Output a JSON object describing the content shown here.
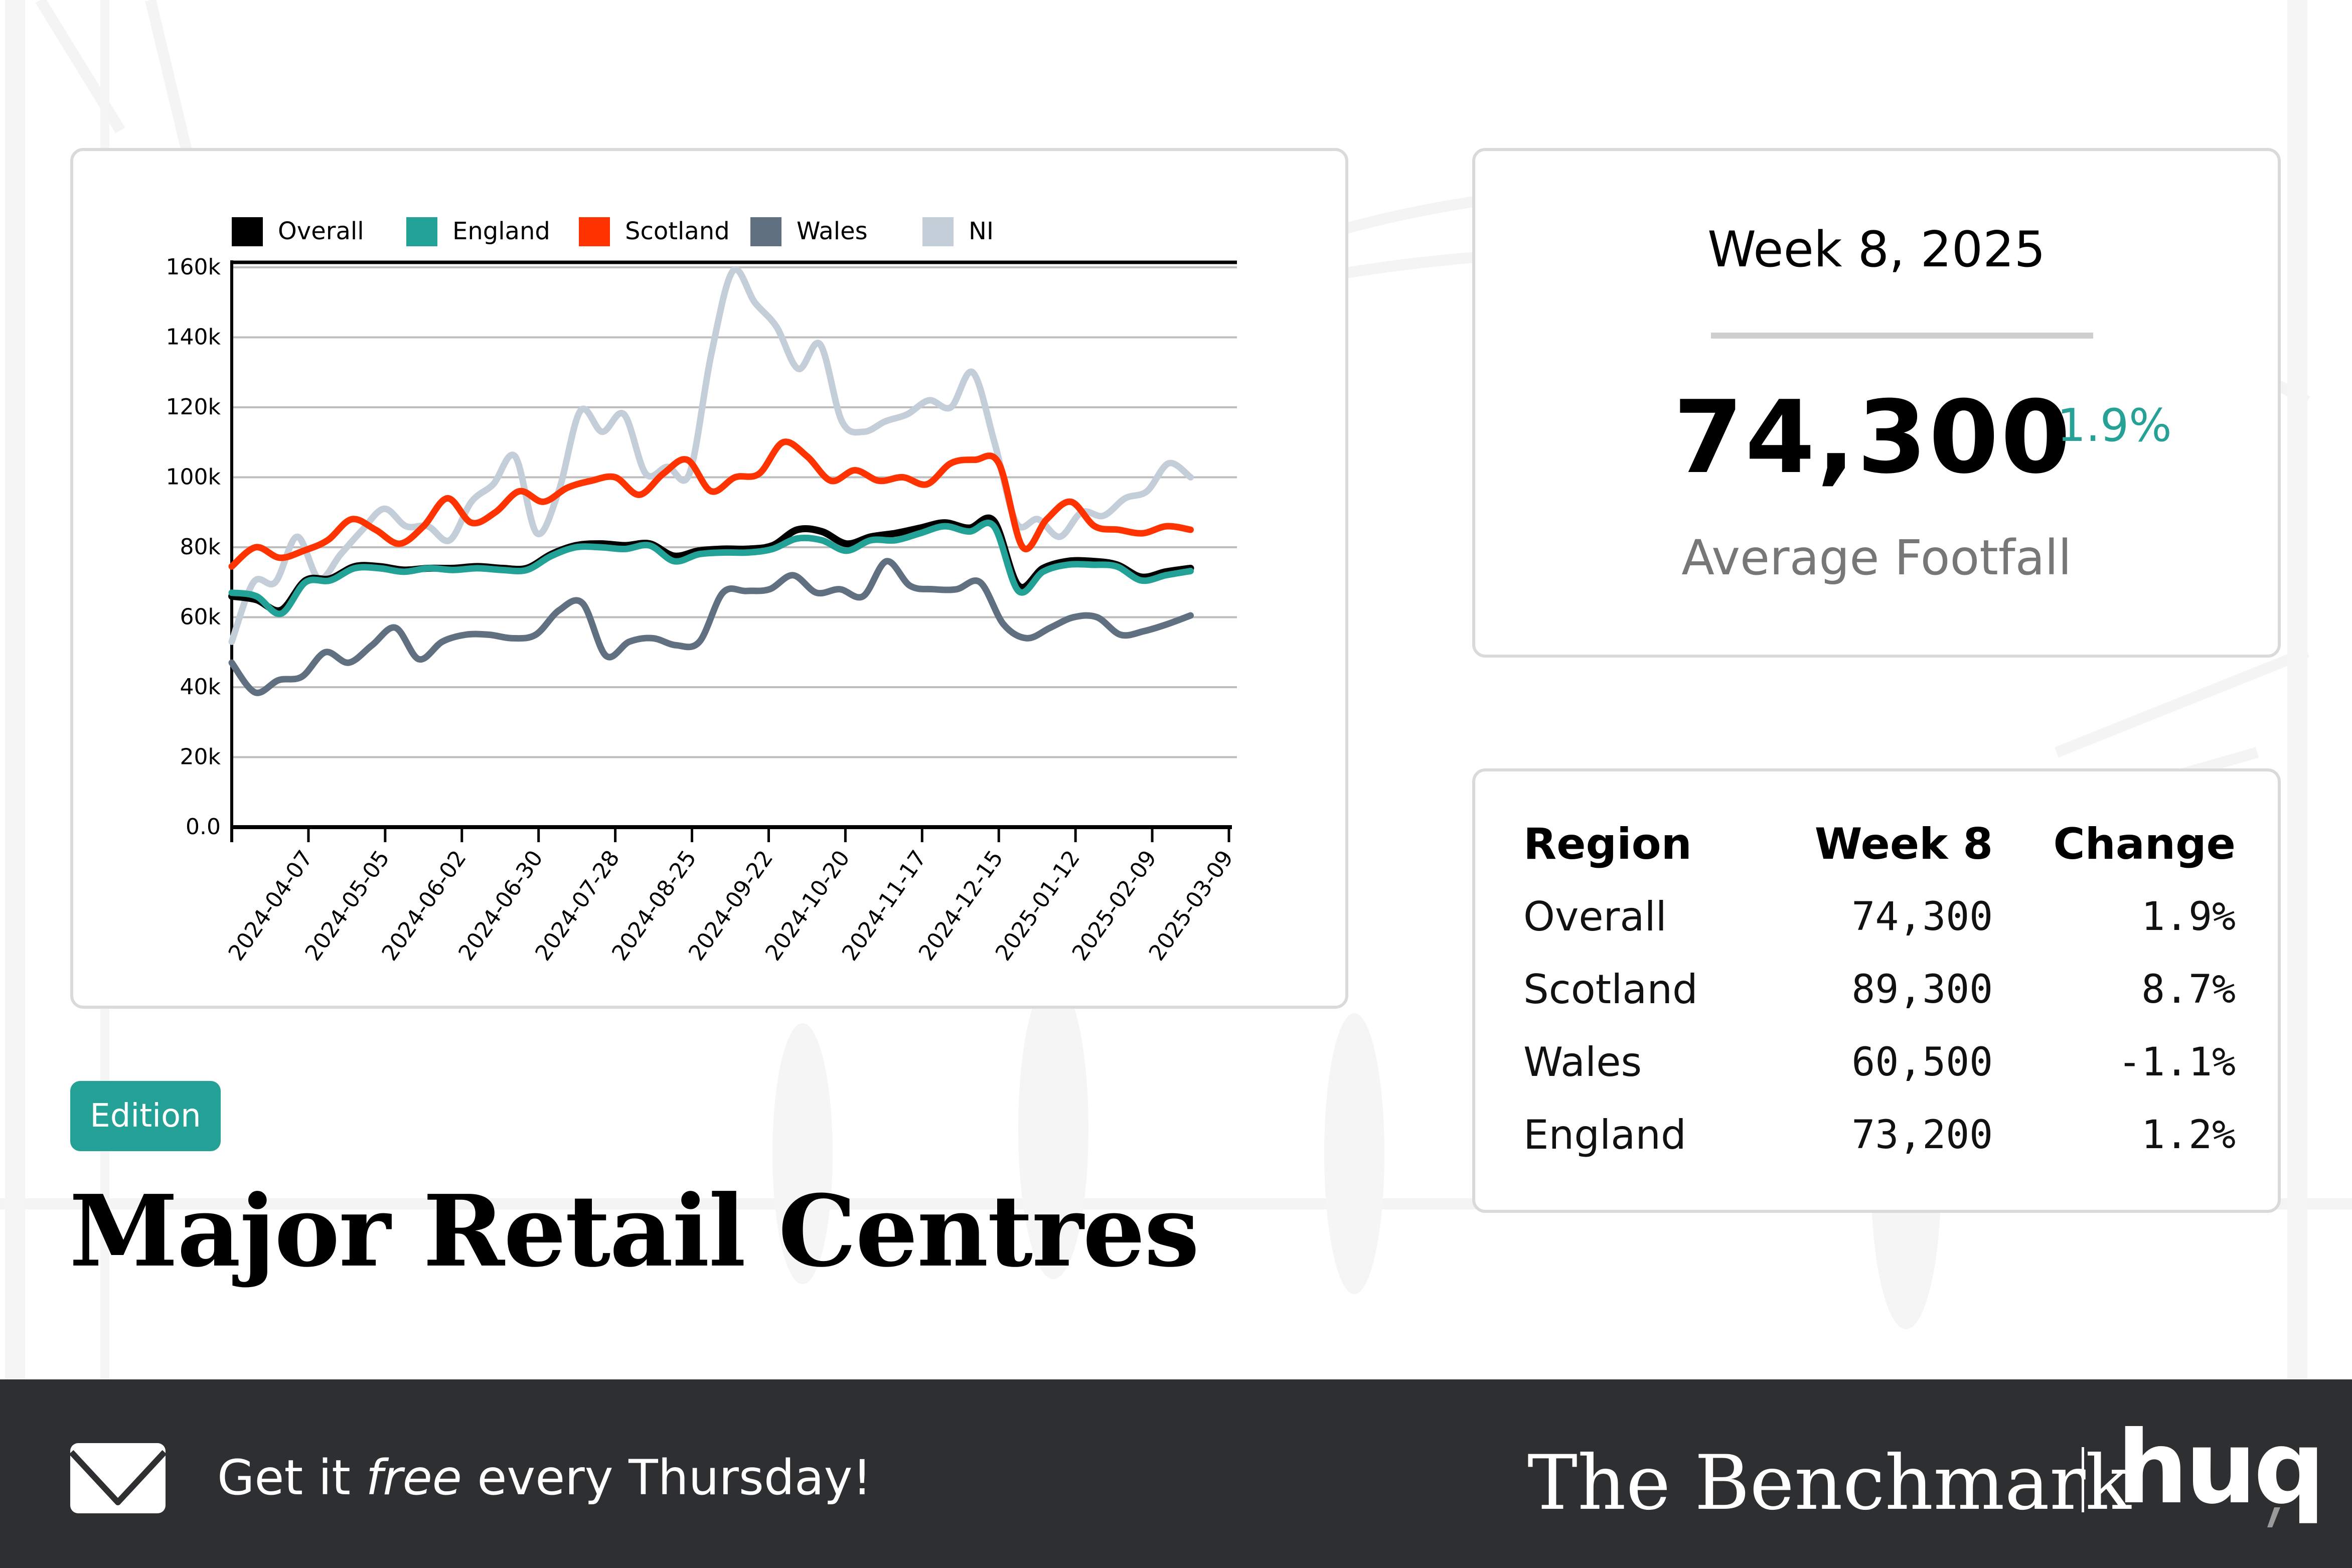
{
  "kpi": {
    "week_label": "Week 8, 2025",
    "value": "74,300",
    "change": "1.9%",
    "label": "Average Footfall",
    "change_color": "#26a196"
  },
  "table": {
    "headers": [
      "Region",
      "Week 8",
      "Change"
    ],
    "rows": [
      {
        "region": "Overall",
        "value": "74,300",
        "change": "1.9%"
      },
      {
        "region": "Scotland",
        "value": "89,300",
        "change": "8.7%"
      },
      {
        "region": "Wales",
        "value": "60,500",
        "change": "-1.1%"
      },
      {
        "region": "England",
        "value": "73,200",
        "change": "1.2%"
      }
    ]
  },
  "badge": "Edition",
  "title": "Major Retail Centres",
  "footer": {
    "cta_before": "Get it ",
    "cta_emphasis": "free",
    "cta_after": " every Thursday!",
    "brand": "The Benchmark",
    "logo": "huq",
    "mail_icon": "envelope-icon"
  },
  "chart_data": {
    "type": "line",
    "title": "",
    "xlabel": "",
    "ylabel": "",
    "ylim": [
      0,
      160000
    ],
    "yticks": [
      0,
      20000,
      40000,
      60000,
      80000,
      100000,
      120000,
      140000,
      160000
    ],
    "ytick_labels": [
      "0.0",
      "20k",
      "40k",
      "60k",
      "80k",
      "100k",
      "120k",
      "140k",
      "160k"
    ],
    "x_start": "2024-03-10",
    "x_end": "2025-03-09",
    "xtick_labels": [
      "2024-04-07",
      "2024-05-05",
      "2024-06-02",
      "2024-06-30",
      "2024-07-28",
      "2024-08-25",
      "2024-09-22",
      "2024-10-20",
      "2024-11-17",
      "2024-12-15",
      "2025-01-12",
      "2025-02-09",
      "2025-03-09"
    ],
    "grid": true,
    "legend_position": "top-left",
    "x_interval": "weekly",
    "series": [
      {
        "name": "NI",
        "color": "#c3ced8",
        "values": [
          53000,
          70000,
          70000,
          83000,
          71000,
          78000,
          85000,
          91000,
          86000,
          86000,
          82000,
          93000,
          98000,
          106000,
          84000,
          96000,
          119000,
          113000,
          118000,
          101000,
          103000,
          101000,
          135000,
          159000,
          150000,
          143000,
          131000,
          138000,
          116000,
          113000,
          116000,
          118000,
          122000,
          120000,
          130000,
          110000,
          87000,
          88000,
          83000,
          90000,
          89000,
          94000,
          96000,
          104000,
          100000
        ]
      },
      {
        "name": "Scotland",
        "color": "#ff3300",
        "values": [
          74500,
          80000,
          77000,
          79000,
          82000,
          88000,
          85000,
          81000,
          86000,
          94000,
          87000,
          90000,
          96000,
          93000,
          97000,
          99000,
          100000,
          95000,
          101000,
          105000,
          96000,
          100000,
          101000,
          110000,
          106000,
          99000,
          102000,
          99000,
          100000,
          98000,
          104000,
          105000,
          104000,
          80000,
          88000,
          93000,
          86000,
          85000,
          84000,
          86000,
          85000
        ]
      },
      {
        "name": "Wales",
        "color": "#607080",
        "values": [
          47000,
          38500,
          42000,
          43000,
          50000,
          47000,
          52000,
          57000,
          48000,
          53000,
          55000,
          55000,
          54000,
          55000,
          62000,
          64000,
          49000,
          53000,
          54000,
          52000,
          53000,
          67000,
          67500,
          68000,
          72000,
          67000,
          68000,
          66000,
          76000,
          69000,
          68000,
          68000,
          70000,
          58000,
          54000,
          57000,
          60000,
          60000,
          55000,
          56000,
          58000,
          60500
        ]
      },
      {
        "name": "Overall",
        "color": "#000000",
        "values": [
          66000,
          65000,
          62000,
          70500,
          71000,
          74500,
          74500,
          73500,
          74000,
          74000,
          74500,
          74000,
          74000,
          78000,
          80500,
          81000,
          80500,
          81000,
          77500,
          79000,
          79500,
          79500,
          80500,
          85000,
          84500,
          81000,
          83000,
          84000,
          85500,
          87000,
          85500,
          87500,
          69000,
          74000,
          76000,
          76000,
          75000,
          71500,
          73000,
          74000
        ]
      },
      {
        "name": "England",
        "color": "#22a297",
        "values": [
          67000,
          66000,
          61000,
          70000,
          70500,
          74000,
          74000,
          73000,
          74000,
          73500,
          74000,
          73500,
          73500,
          77500,
          80000,
          80000,
          79500,
          80500,
          76000,
          78000,
          78500,
          78500,
          79500,
          82500,
          82000,
          79000,
          82000,
          82000,
          84000,
          86000,
          84500,
          86000,
          67500,
          73000,
          75000,
          75000,
          74500,
          70500,
          72000,
          73200
        ]
      }
    ]
  }
}
